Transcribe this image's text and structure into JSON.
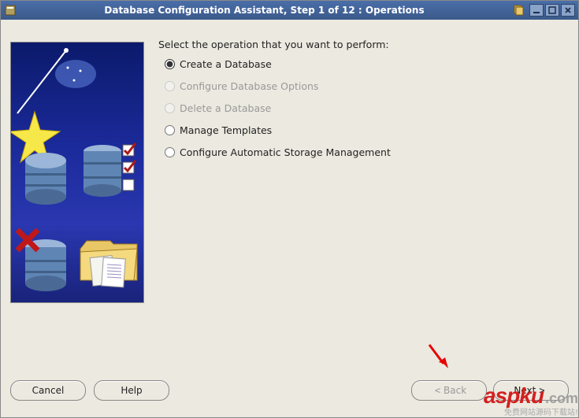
{
  "titlebar": {
    "title": "Database Configuration Assistant, Step 1 of 12 : Operations"
  },
  "content": {
    "prompt": "Select the operation that you want to perform:",
    "options": [
      {
        "label": "Create a Database",
        "selected": true,
        "enabled": true
      },
      {
        "label": "Configure Database Options",
        "selected": false,
        "enabled": false
      },
      {
        "label": "Delete a Database",
        "selected": false,
        "enabled": false
      },
      {
        "label": "Manage Templates",
        "selected": false,
        "enabled": true
      },
      {
        "label": "Configure Automatic Storage Management",
        "selected": false,
        "enabled": true
      }
    ]
  },
  "footer": {
    "cancel": "Cancel",
    "help": "Help",
    "back": "Back",
    "next": "Next"
  },
  "watermark": {
    "brand": "aspku",
    "dotcom": ".com",
    "subtitle": "免费网站源码下载站!"
  }
}
